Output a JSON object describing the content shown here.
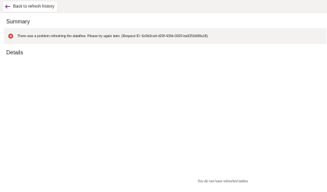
{
  "toolbar": {
    "back_label": "Back to refresh history",
    "back_icon": "arrow-left-icon"
  },
  "summary": {
    "heading": "Summary",
    "error_icon": "error-circle-icon",
    "error_color": "#d13438",
    "error_message": "There was a problem refreshing the dataflow. Please try again later. (Request ID: 6e9b3ca4-d29f-435b-9920-ba9259d98a18)."
  },
  "details": {
    "heading": "Details",
    "empty_message": "You do not have refreshed tables."
  }
}
